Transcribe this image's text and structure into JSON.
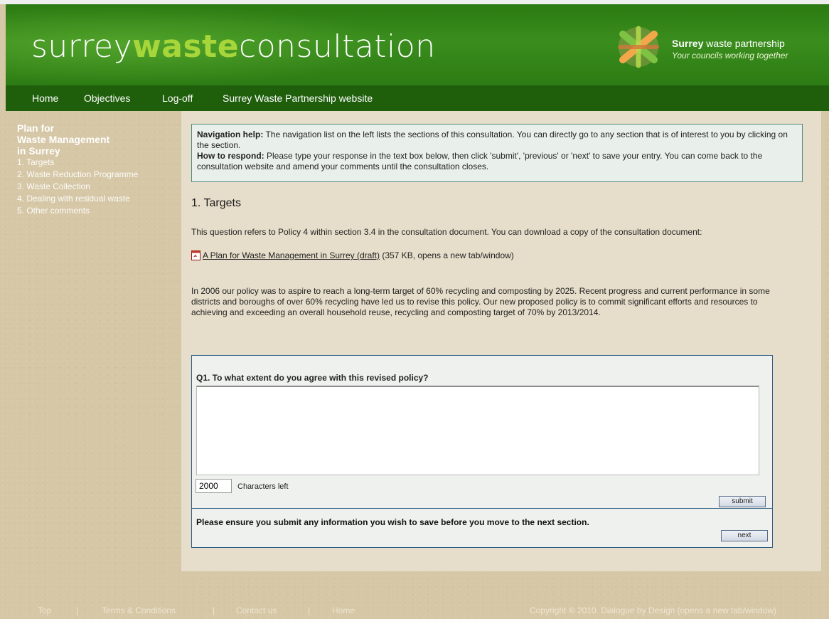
{
  "header": {
    "logo_part1": "surrey",
    "logo_part2": "waste",
    "logo_part3": "consultation",
    "partner_bold": "Surrey",
    "partner_rest": " waste partnership",
    "partner_tagline": "Your councils working together"
  },
  "nav": {
    "items": [
      "Home",
      "Objectives",
      "Log-off",
      "Surrey Waste Partnership website"
    ]
  },
  "sidebar": {
    "title_lines": [
      "Plan for",
      "Waste Management",
      "in Surrey"
    ],
    "items": [
      "1. Targets",
      "2. Waste Reduction Programme",
      "3. Waste Collection",
      "4. Dealing with residual waste",
      "5. Other comments"
    ]
  },
  "help": {
    "nav_label": "Navigation help:",
    "nav_text": " The navigation list on the left lists the sections of this consultation. You can directly go to any section that is of interest to you by clicking on the section.",
    "respond_label": "How to respond:",
    "respond_text": " Please type your response in the text box below, then click 'submit', 'previous' or 'next' to save your entry. You can come back to the consultation website and amend your comments until the consultation closes."
  },
  "section": {
    "title": "1. Targets",
    "intro": "This question refers to Policy 4 within section 3.4 in the consultation document. You can download a copy of the consultation document:",
    "doc_link": "A Plan for Waste Management in Surrey (draft)",
    "doc_meta": " (357 KB, opens a new tab/window)",
    "policy_text": "In 2006 our policy was to aspire to reach a long-term target of 60% recycling and composting by 2025. Recent progress and current performance in some districts and boroughs of over 60% recycling have led us to revise this policy. Our new proposed policy is to commit significant efforts and resources to achieving and exceeding an overall household reuse, recycling and composting target of 70% by 2013/2014."
  },
  "question": {
    "label": "Q1. To what extent do you agree with this revised policy?",
    "response": "",
    "chars_left": "2000",
    "chars_label": "Characters left",
    "submit_label": "submit",
    "ensure_text": "Please ensure you submit any information you wish to save before you move to the next section.",
    "next_label": "next"
  },
  "footer": {
    "links": [
      "Top",
      "Terms & Conditions",
      "Contact us",
      "Home"
    ],
    "separator": "|",
    "copyright": "Copyright © 2010. Dialogue by Design (opens a new tab/window)"
  },
  "colors": {
    "header_green": "#2d7c14",
    "nav_green": "#1f5f0c",
    "logo_accent": "#a7d63a",
    "help_border": "#4f8a7c",
    "question_border": "#2c5d85"
  }
}
